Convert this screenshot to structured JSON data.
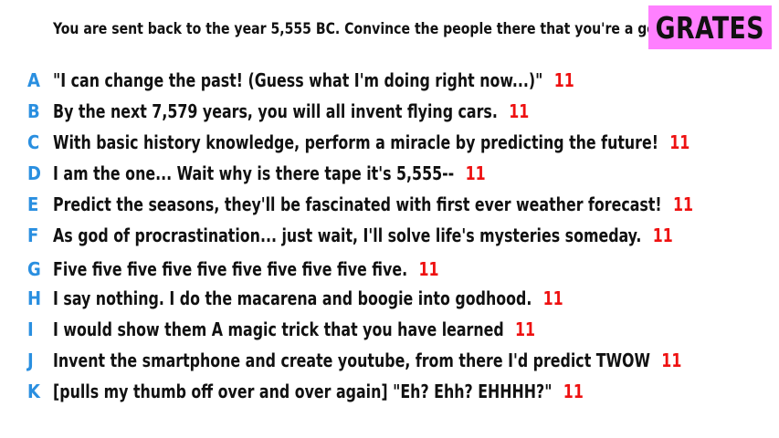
{
  "prompt": "You are sent back to the year 5,555 BC. Convince the people there that you're a god.",
  "badge": {
    "label": "GRATES",
    "bg_color": "#ff80ff"
  },
  "colors": {
    "letter": "#2a8fe0",
    "count": "#ee1111",
    "text": "#111111"
  },
  "responses": [
    {
      "letter": "A",
      "text": "\"I can change the past! (Guess what I'm doing right now...)\"",
      "count": "11"
    },
    {
      "letter": "B",
      "text": "By the next 7,579 years, you will all invent flying cars.",
      "count": "11"
    },
    {
      "letter": "C",
      "text": "With basic history knowledge, perform a miracle by predicting the future!",
      "count": "11"
    },
    {
      "letter": "D",
      "text": "I am the one... Wait why is there tape it's 5,555--",
      "count": "11"
    },
    {
      "letter": "E",
      "text": "Predict the seasons, they'll be fascinated with first ever weather forecast!",
      "count": "11"
    },
    {
      "letter": "F",
      "text": "As god of procrastination... just wait, I'll solve life's mysteries someday.",
      "count": "11"
    },
    {
      "letter": "G",
      "text": "Five five five five five five five five five five.",
      "count": "11"
    },
    {
      "letter": "H",
      "text": "I say nothing. I do the macarena and boogie into godhood.",
      "count": "11"
    },
    {
      "letter": "I",
      "text": "I would show them A magic trick that you have learned",
      "count": "11"
    },
    {
      "letter": "J",
      "text": "Invent the smartphone and create youtube, from there I'd predict TWOW",
      "count": "11"
    },
    {
      "letter": "K",
      "text": "[pulls my thumb off over and over again] \"Eh? Ehh? EHHHH?\"",
      "count": "11"
    }
  ]
}
